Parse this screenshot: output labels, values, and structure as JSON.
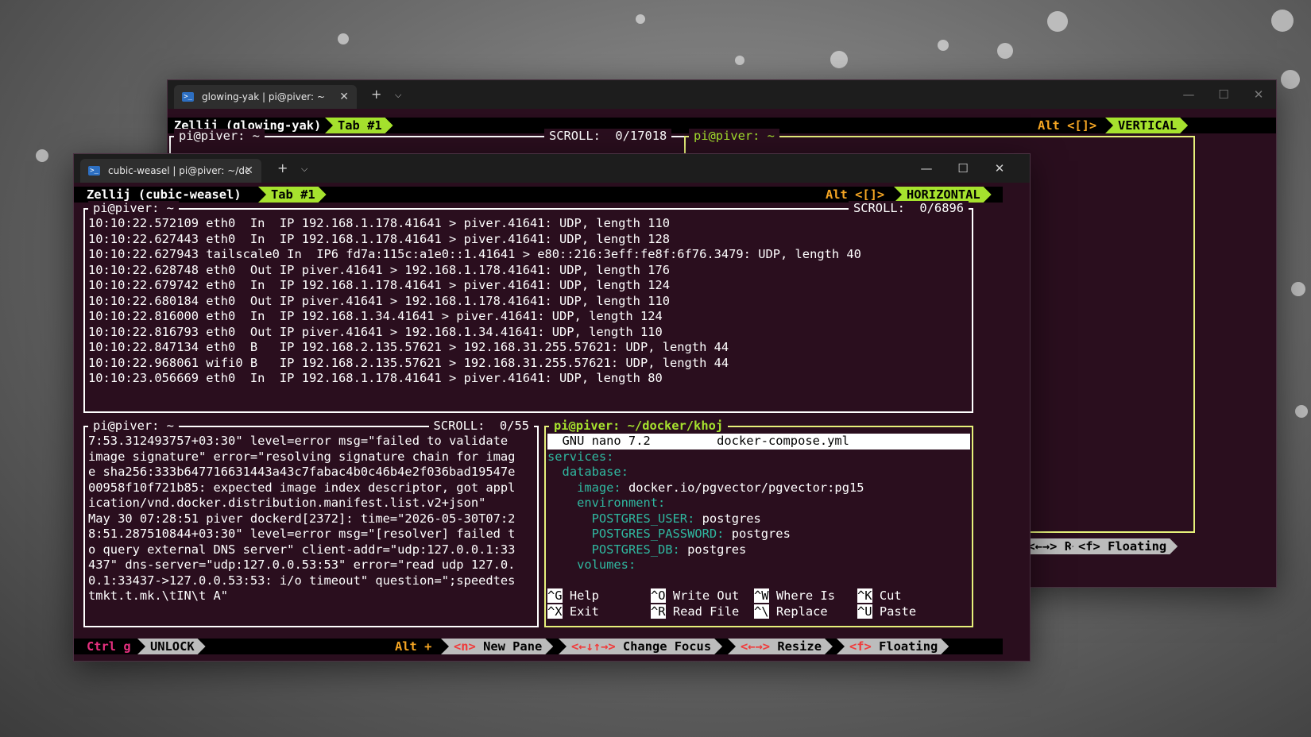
{
  "back_window": {
    "tab_title": "glowing-yak | pi@piver: ~",
    "zellij_session": "Zellij (glowing-yak)",
    "tab_label": "Tab #1",
    "alt_hint": "Alt <[]>",
    "layout_mode": "VERTICAL",
    "left_pane_title": "pi@piver: ~",
    "left_pane_scroll": "SCROLL:  0/17018",
    "right_pane_title": "pi@piver: ~",
    "status_resize": "<←→> Resize",
    "status_floating": "<f> Floating"
  },
  "front_window": {
    "tab_title": "cubic-weasel | pi@piver: ~/dc",
    "zellij_session": "Zellij (cubic-weasel)",
    "tab_label": "Tab #1",
    "alt_hint": "Alt <[]>",
    "layout_mode": "HORIZONTAL",
    "top_pane": {
      "title": "pi@piver: ~",
      "scroll": "SCROLL:  0/6896",
      "lines": [
        "10:10:22.572109 eth0  In  IP 192.168.1.178.41641 > piver.41641: UDP, length 110",
        "10:10:22.627443 eth0  In  IP 192.168.1.178.41641 > piver.41641: UDP, length 128",
        "10:10:22.627943 tailscale0 In  IP6 fd7a:115c:a1e0::1.41641 > e80::216:3eff:fe8f:6f76.3479: UDP, length 40",
        "10:10:22.628748 eth0  Out IP piver.41641 > 192.168.1.178.41641: UDP, length 176",
        "10:10:22.679742 eth0  In  IP 192.168.1.178.41641 > piver.41641: UDP, length 124",
        "10:10:22.680184 eth0  Out IP piver.41641 > 192.168.1.178.41641: UDP, length 110",
        "10:10:22.816000 eth0  In  IP 192.168.1.34.41641 > piver.41641: UDP, length 124",
        "10:10:22.816793 eth0  Out IP piver.41641 > 192.168.1.34.41641: UDP, length 110",
        "10:10:22.847134 eth0  B   IP 192.168.2.135.57621 > 192.168.31.255.57621: UDP, length 44",
        "10:10:22.968061 wifi0 B   IP 192.168.2.135.57621 > 192.168.31.255.57621: UDP, length 44",
        "10:10:23.056669 eth0  In  IP 192.168.1.178.41641 > piver.41641: UDP, length 80"
      ]
    },
    "bottom_left_pane": {
      "title": "pi@piver: ~",
      "scroll": "SCROLL:  0/55",
      "lines": [
        "7:53.312493757+03:30\" level=error msg=\"failed to validate",
        "image signature\" error=\"resolving signature chain for imag",
        "e sha256:333b647716631443a43c7fabac4b0c46b4e2f036bad19547e",
        "00958f10f721b85: expected image index descriptor, got appl",
        "ication/vnd.docker.distribution.manifest.list.v2+json\"",
        "May 30 07:28:51 piver dockerd[2372]: time=\"2026-05-30T07:2",
        "8:51.287510844+03:30\" level=error msg=\"[resolver] failed t",
        "o query external DNS server\" client-addr=\"udp:127.0.0.1:33",
        "437\" dns-server=\"udp:127.0.0.53:53\" error=\"read udp 127.0.",
        "0.1:33437->127.0.0.53:53: i/o timeout\" question=\";speedtes",
        "tmkt.t.mk.\\tIN\\t A\""
      ]
    },
    "nano_pane": {
      "title": "pi@piver: ~/docker/khoj",
      "nano_version": "  GNU nano 7.2",
      "file_name": "docker-compose.yml",
      "yaml": {
        "services": "services",
        "database": "database",
        "image_key": "image",
        "image_val": "docker.io/pgvector/pgvector:pg15",
        "environment": "environment",
        "user_key": "POSTGRES_USER",
        "user_val": "postgres",
        "pass_key": "POSTGRES_PASSWORD",
        "pass_val": "postgres",
        "db_key": "POSTGRES_DB",
        "db_val": "postgres",
        "volumes": "volumes"
      },
      "shortcuts": [
        {
          "key": "^G",
          "label": "Help"
        },
        {
          "key": "^O",
          "label": "Write Out"
        },
        {
          "key": "^W",
          "label": "Where Is"
        },
        {
          "key": "^K",
          "label": "Cut"
        },
        {
          "key": "^X",
          "label": "Exit"
        },
        {
          "key": "^R",
          "label": "Read File"
        },
        {
          "key": "^\\",
          "label": "Replace"
        },
        {
          "key": "^U",
          "label": "Paste"
        }
      ]
    },
    "status_bar": {
      "ctrl": "Ctrl g",
      "unlock": "UNLOCK",
      "alt": "Alt +",
      "new_pane_key": "<n>",
      "new_pane": "New Pane",
      "focus_key": "<←↓↑→>",
      "focus": "Change Focus",
      "resize_key": "<←→>",
      "resize": "Resize",
      "floating_key": "<f>",
      "floating": "Floating"
    }
  },
  "colors": {
    "terminal_bg": "#2a0e1e",
    "zellij_green": "#a6e22e",
    "focus_border": "#e6f07a",
    "yaml_key": "#2fb8a0",
    "hint_orange": "#f6a623",
    "ctrl_magenta": "#e6307f",
    "key_red": "#f03a3a"
  }
}
